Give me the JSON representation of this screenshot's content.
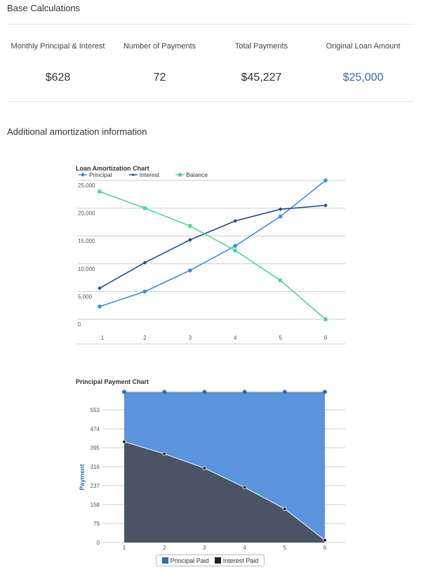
{
  "base": {
    "title": "Base Calculations",
    "stats": [
      {
        "label": "Monthly Principal & Interest",
        "value": "$628"
      },
      {
        "label": "Number of Payments",
        "value": "72"
      },
      {
        "label": "Total Payments",
        "value": "$45,227"
      },
      {
        "label": "Original Loan Amount",
        "value": "$25,000"
      }
    ]
  },
  "additional": {
    "title": "Additional amortization information"
  },
  "colors": {
    "principal": "#3b8fe0",
    "interest": "#1f4e8c",
    "balance": "#4fd69a",
    "principal_area": "#5b93dd",
    "interest_area": "#4a5563",
    "link_blue": "#2f6fb0"
  },
  "chart_data": [
    {
      "type": "line",
      "title": "Loan Amortization Chart",
      "x": [
        1,
        2,
        3,
        4,
        5,
        6
      ],
      "series": [
        {
          "name": "Principal",
          "values": [
            2300,
            5000,
            8800,
            13200,
            18500,
            25000
          ]
        },
        {
          "name": "Interest",
          "values": [
            5600,
            10200,
            14300,
            17700,
            19800,
            20500
          ]
        },
        {
          "name": "Balance",
          "values": [
            23000,
            20000,
            16800,
            12400,
            7000,
            0
          ]
        }
      ],
      "yticks": [
        "0",
        "5,000",
        "10,000",
        "15,000",
        "20,000",
        "25,000"
      ],
      "ylim": [
        0,
        25000
      ],
      "legend": "top-left",
      "grid": true
    },
    {
      "type": "area",
      "title": "Principal Payment Chart",
      "ylabel": "Payment",
      "x": [
        1,
        2,
        3,
        4,
        5,
        6
      ],
      "series": [
        {
          "name": "Principal Paid",
          "values": [
            628,
            628,
            628,
            628,
            628,
            628
          ]
        },
        {
          "name": "Interest Paid",
          "values": [
            420,
            370,
            310,
            230,
            140,
            10
          ]
        }
      ],
      "yticks": [
        "0",
        "79",
        "158",
        "237",
        "316",
        "395",
        "474",
        "553"
      ],
      "ylim": [
        0,
        632
      ],
      "legend": "bottom-center",
      "grid": true
    }
  ]
}
